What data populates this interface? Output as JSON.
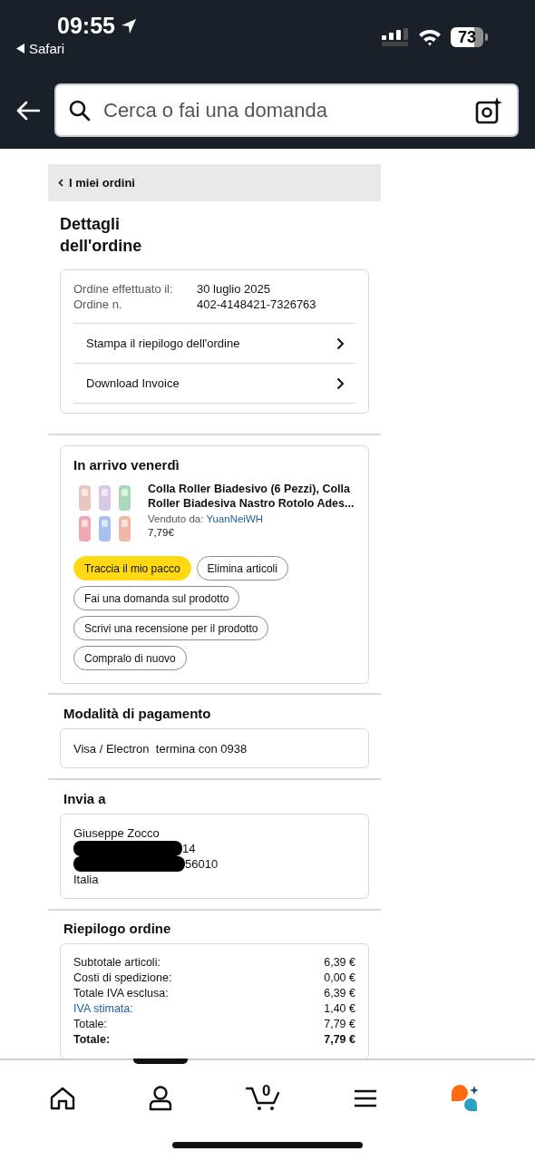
{
  "status_bar": {
    "time": "09:55",
    "back_app": "Safari",
    "battery": "73"
  },
  "search": {
    "placeholder": "Cerca o fai una domanda"
  },
  "breadcrumb": {
    "label": "I miei ordini"
  },
  "title": "Dettagli dell'ordine",
  "order_info": {
    "rows": [
      {
        "label": "Ordine effettuato il:",
        "value": "30 luglio 2025"
      },
      {
        "label": "Ordine n.",
        "value": "402-4148421-7326763"
      }
    ],
    "links": [
      "Stampa il riepilogo dell'ordine",
      "Download Invoice"
    ]
  },
  "shipment": {
    "heading": "In arrivo venerdì",
    "product": {
      "title": "Colla Roller Biadesivo (6 Pezzi), Colla Roller Biadesiva Nastro Rotolo Ades...",
      "seller_label": "Venduto da:",
      "seller": "YuanNeiWH",
      "price": "7,79€"
    },
    "actions": [
      {
        "label": "Traccia il mio pacco",
        "kind": "primary"
      },
      {
        "label": "Elimina articoli",
        "kind": "outline"
      },
      {
        "label": "Fai una domanda sul prodotto",
        "kind": "outline"
      },
      {
        "label": "Scrivi una recensione per il prodotto",
        "kind": "outline"
      },
      {
        "label": "Compralo di nuovo",
        "kind": "outline"
      }
    ]
  },
  "payment": {
    "heading": "Modalità di pagamento",
    "method": "Visa / Electron",
    "ending": "termina con 0938"
  },
  "ship_to": {
    "heading": "Invia a",
    "lines": [
      {
        "kind": "text",
        "text": "Giuseppe Zocco"
      },
      {
        "kind": "redacted",
        "text": "14"
      },
      {
        "kind": "redacted",
        "text": "56010"
      },
      {
        "kind": "text",
        "text": "Italia"
      }
    ]
  },
  "summary": {
    "heading": "Riepilogo ordine",
    "rows": [
      {
        "kind": "plain",
        "label": "Subtotale articoli:",
        "value": "6,39 €"
      },
      {
        "kind": "plain",
        "label": "Costi di spedizione:",
        "value": "0,00 €"
      },
      {
        "kind": "plain",
        "label": "Totale IVA esclusa:",
        "value": "6,39 €"
      },
      {
        "kind": "link",
        "label": "IVA stimata:",
        "value": "1,40 €"
      },
      {
        "kind": "plain",
        "label": "Totale:",
        "value": "7,79 €"
      },
      {
        "kind": "bold",
        "label": "Totale:",
        "value": "7,79 €"
      }
    ]
  },
  "nav": {
    "items": [
      {
        "kind": "home"
      },
      {
        "kind": "account"
      },
      {
        "kind": "cart",
        "count": "0"
      },
      {
        "kind": "menu"
      },
      {
        "kind": "assistant"
      }
    ]
  }
}
